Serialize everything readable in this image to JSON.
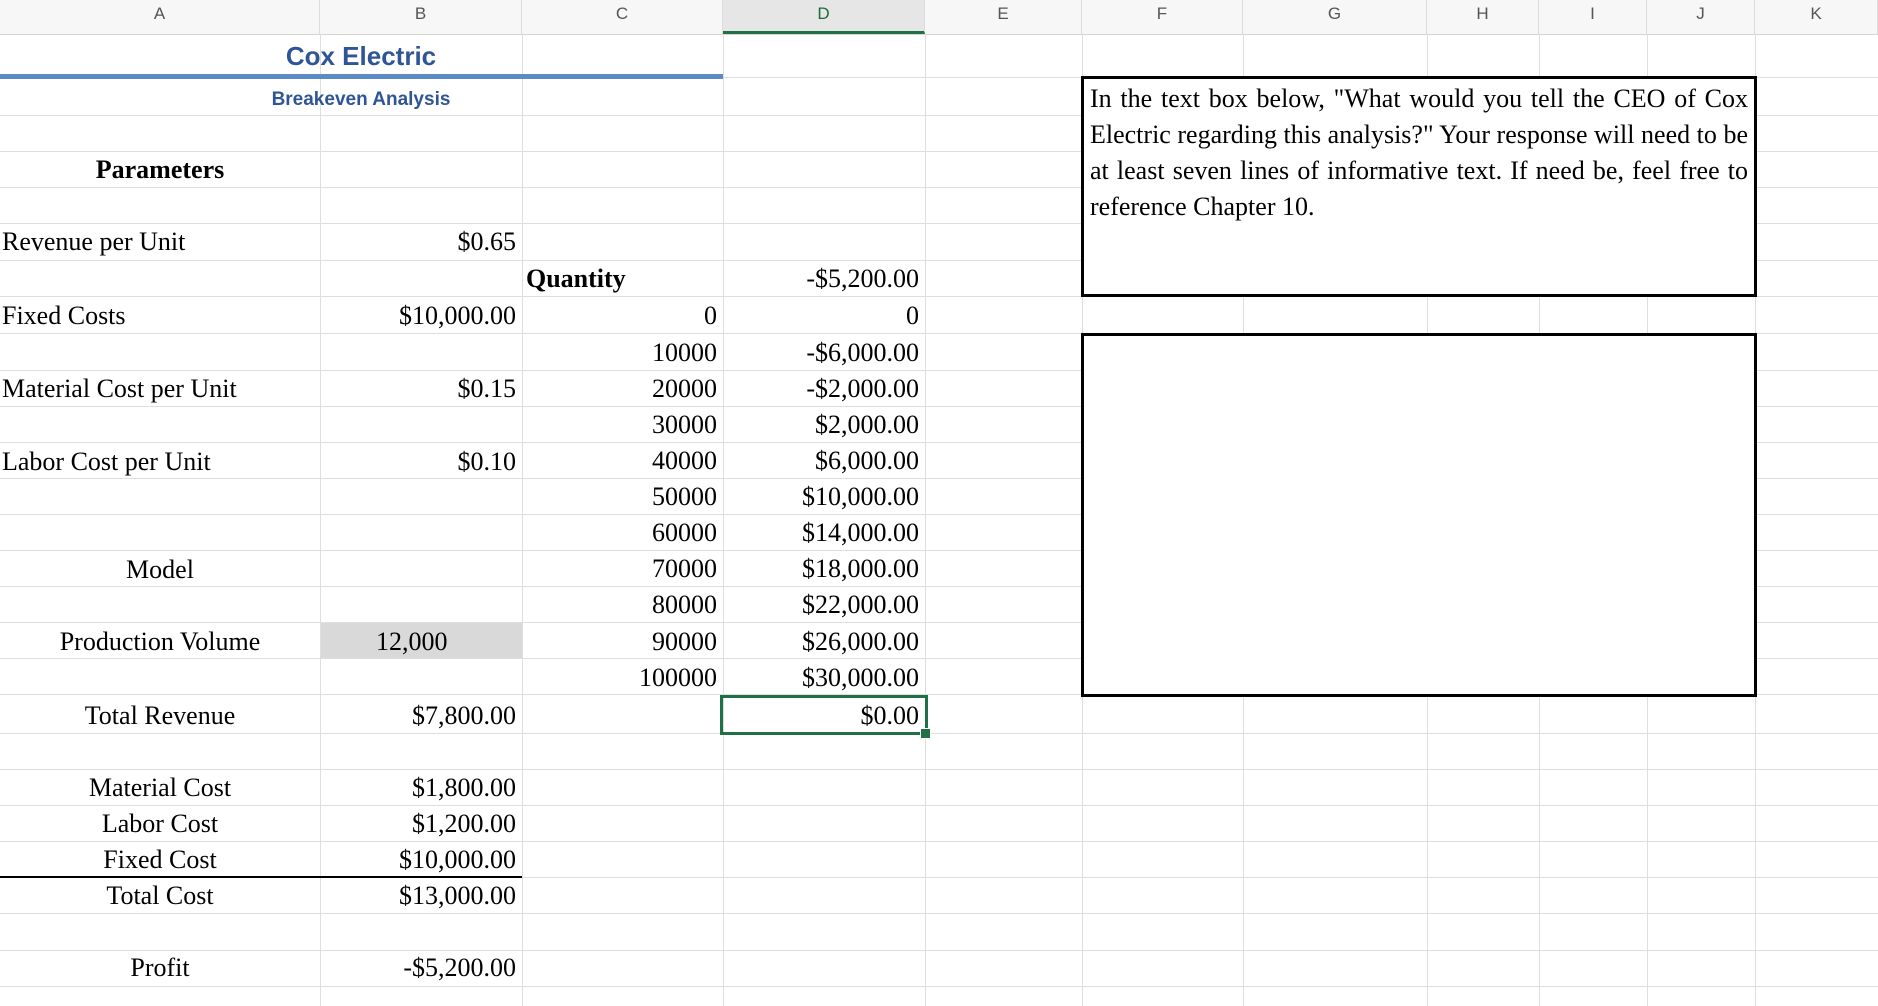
{
  "column_headers": [
    "A",
    "B",
    "C",
    "D",
    "E",
    "F",
    "G",
    "H",
    "I",
    "J",
    "K"
  ],
  "selected_column": "D",
  "header": {
    "title": "Cox Electric",
    "subtitle": "Breakeven Analysis"
  },
  "parameters": {
    "label": "Parameters",
    "revenue_label": "Revenue per Unit",
    "revenue_value": "$0.65",
    "fixed_label": "Fixed Costs",
    "fixed_value": "$10,000.00",
    "material_label": "Material Cost per Unit",
    "material_value": "$0.15",
    "labor_label": "Labor Cost per Unit",
    "labor_value": "$0.10"
  },
  "model": {
    "label": "Model",
    "volume_label": "Production Volume",
    "volume_value": "12,000",
    "revenue_label": "Total Revenue",
    "revenue_value": "$7,800.00",
    "material_label": "Material Cost",
    "material_value": "$1,800.00",
    "labor_label": "Labor Cost",
    "labor_value": "$1,200.00",
    "fixed_label": "Fixed Cost",
    "fixed_value": "$10,000.00",
    "total_label": "Total Cost",
    "total_value": "$13,000.00",
    "profit_label": "Profit",
    "profit_value": "-$5,200.00"
  },
  "table": {
    "quantity_header": "Quantity",
    "profit_header": "-$5,200.00",
    "rows": [
      {
        "q": "0",
        "p": "0"
      },
      {
        "q": "10000",
        "p": "-$6,000.00"
      },
      {
        "q": "20000",
        "p": "-$2,000.00"
      },
      {
        "q": "30000",
        "p": "$2,000.00"
      },
      {
        "q": "40000",
        "p": "$6,000.00"
      },
      {
        "q": "50000",
        "p": "$10,000.00"
      },
      {
        "q": "60000",
        "p": "$14,000.00"
      },
      {
        "q": "70000",
        "p": "$18,000.00"
      },
      {
        "q": "80000",
        "p": "$22,000.00"
      },
      {
        "q": "90000",
        "p": "$26,000.00"
      },
      {
        "q": "100000",
        "p": "$30,000.00"
      }
    ],
    "selected_cell_value": "$0.00"
  },
  "instructions": {
    "text": "In the text box below, \"What would you tell the CEO of Cox Electric regarding this analysis?\"  Your response will need to be at least seven lines of informative text.  If need be, feel free to reference Chapter 10."
  },
  "response_box": {
    "value": ""
  }
}
